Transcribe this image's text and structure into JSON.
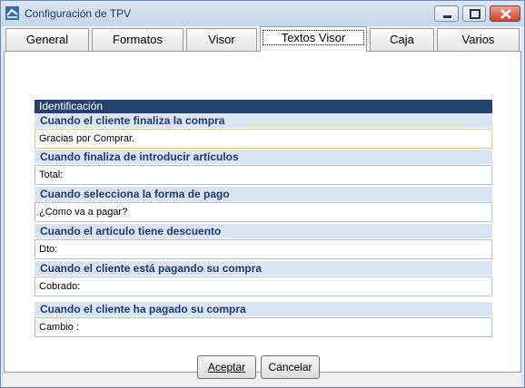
{
  "window": {
    "title": "Configuración de TPV"
  },
  "tabs": [
    {
      "label": "General"
    },
    {
      "label": "Formatos"
    },
    {
      "label": "Visor"
    },
    {
      "label": "Textos Visor"
    },
    {
      "label": "Caja"
    },
    {
      "label": "Varios"
    }
  ],
  "active_tab": "Textos Visor",
  "panel": {
    "section_header": "Identificación",
    "items": [
      {
        "label": "Cuando el cliente finaliza la compra",
        "value": "Gracias por Comprar."
      },
      {
        "label": "Cuando finaliza de introducir artículos",
        "value": "Total:"
      },
      {
        "label": "Cuando selecciona la forma de pago",
        "value": "¿Como va a pagar?"
      },
      {
        "label": "Cuando el artículo tiene descuento",
        "value": "Dto:"
      },
      {
        "label": "Cuando el cliente está pagando su compra",
        "value": "Cobrado:"
      },
      {
        "label": "Cuando el cliente ha pagado su compra",
        "value": "Cambio :"
      }
    ]
  },
  "buttons": {
    "accept_label": "Aceptar",
    "cancel_label": "Cancelar"
  }
}
